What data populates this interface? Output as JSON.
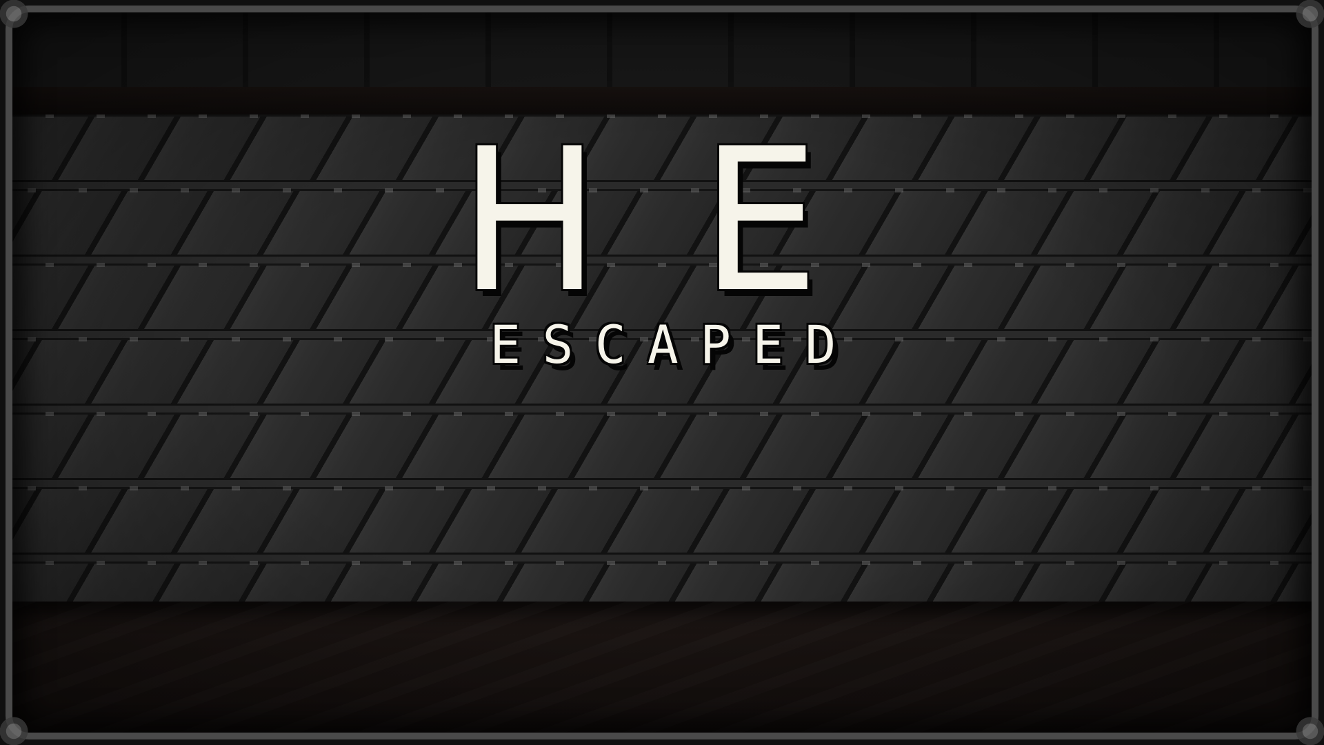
{
  "game": {
    "title_main": "HE",
    "title_sub": "ESCAPED"
  },
  "colors": {
    "title_text": "#f6f4ea",
    "background": "#1b1b1b",
    "tile": "#2b2b2b"
  }
}
